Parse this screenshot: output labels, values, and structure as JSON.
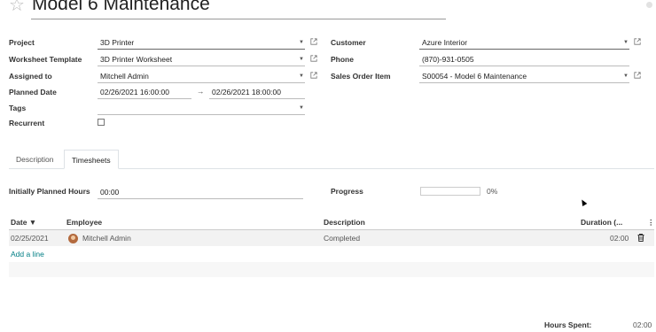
{
  "header": {
    "title": "Model 6 Maintenance"
  },
  "form": {
    "project": {
      "label": "Project",
      "value": "3D Printer"
    },
    "worksheet_template": {
      "label": "Worksheet Template",
      "value": "3D Printer Worksheet"
    },
    "assigned_to": {
      "label": "Assigned to",
      "value": "Mitchell Admin"
    },
    "planned_date": {
      "label": "Planned Date",
      "start": "02/26/2021 16:00:00",
      "arrow": "→",
      "end": "02/26/2021 18:00:00"
    },
    "tags": {
      "label": "Tags",
      "value": ""
    },
    "recurrent": {
      "label": "Recurrent",
      "checked": false
    },
    "customer": {
      "label": "Customer",
      "value": "Azure Interior"
    },
    "phone": {
      "label": "Phone",
      "value": "(870)-931-0505"
    },
    "sales_order_item": {
      "label": "Sales Order Item",
      "value": "S00054 - Model 6 Maintenance"
    }
  },
  "tabs": [
    {
      "label": "Description",
      "active": false
    },
    {
      "label": "Timesheets",
      "active": true
    }
  ],
  "timesheets": {
    "initially_planned_label": "Initially Planned Hours",
    "initially_planned_value": "00:00",
    "progress_label": "Progress",
    "progress_value": "0%",
    "progress_fraction": 0,
    "columns": {
      "date": "Date ▼",
      "employee": "Employee",
      "description": "Description",
      "duration": "Duration (...",
      "more": "⋮"
    },
    "rows": [
      {
        "date": "02/25/2021",
        "employee": "Mitchell Admin",
        "description": "Completed",
        "duration": "02:00"
      }
    ],
    "add_line": "Add a line",
    "hours_spent_label": "Hours Spent:",
    "hours_spent_value": "02:00"
  },
  "icons": {
    "star": "☆",
    "caret": "▼",
    "trash": "trash-icon",
    "external": "external-link-icon"
  }
}
